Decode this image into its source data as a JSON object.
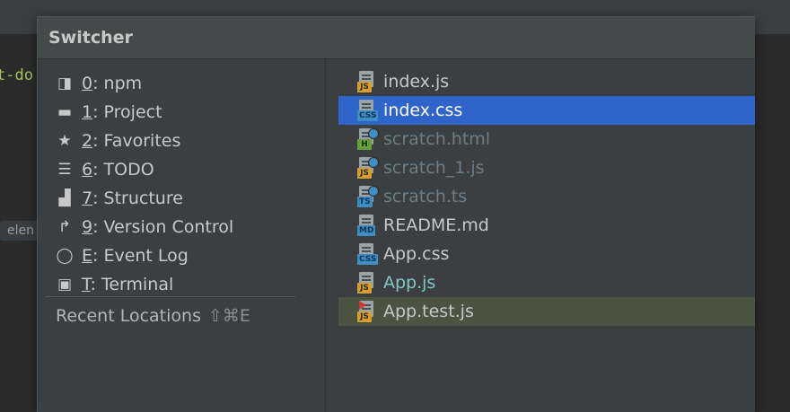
{
  "editor": {
    "code_fragment": "t-do",
    "chip_fragment": "elen"
  },
  "switcher": {
    "title": "Switcher",
    "tool_windows": [
      {
        "icon": "npm-icon",
        "mnemonic": "0",
        "label": ": npm"
      },
      {
        "icon": "folder-icon",
        "mnemonic": "1",
        "label": ": Project"
      },
      {
        "icon": "star-icon",
        "mnemonic": "2",
        "label": ": Favorites"
      },
      {
        "icon": "todo-list-icon",
        "mnemonic": "6",
        "label": ": TODO"
      },
      {
        "icon": "structure-icon",
        "mnemonic": "7",
        "label": ": Structure"
      },
      {
        "icon": "version-control-icon",
        "mnemonic": "9",
        "label": ": Version Control"
      },
      {
        "icon": "event-log-icon",
        "mnemonic": "E",
        "label": ": Event Log"
      },
      {
        "icon": "terminal-icon",
        "mnemonic": "T",
        "label": ": Terminal"
      }
    ],
    "recent_locations": {
      "label": "Recent Locations",
      "shortcut": "⇧⌘E"
    },
    "files": [
      {
        "name": "index.js",
        "type": "JS",
        "state": "normal"
      },
      {
        "name": "index.css",
        "type": "CSS",
        "state": "selected"
      },
      {
        "name": "scratch.html",
        "type": "H",
        "state": "scratch"
      },
      {
        "name": "scratch_1.js",
        "type": "JS",
        "state": "scratch"
      },
      {
        "name": "scratch.ts",
        "type": "TS",
        "state": "scratch"
      },
      {
        "name": "README.md",
        "type": "MD",
        "state": "normal"
      },
      {
        "name": "App.css",
        "type": "CSS",
        "state": "normal"
      },
      {
        "name": "App.js",
        "type": "JS",
        "state": "modified"
      },
      {
        "name": "App.test.js",
        "type": "JS",
        "state": "tested"
      }
    ]
  },
  "colors": {
    "selection": "#2f65ca",
    "test_row": "#4a5441",
    "scratch_text": "#6b7d87",
    "modified_text": "#83c7c4"
  }
}
